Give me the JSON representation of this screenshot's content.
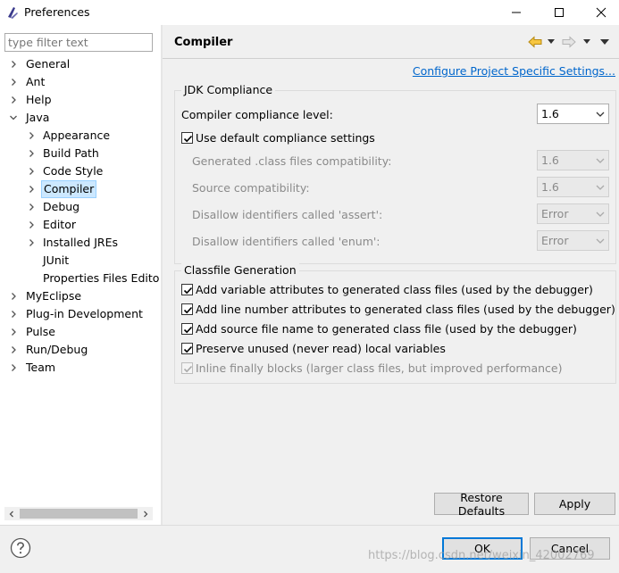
{
  "window": {
    "title": "Preferences",
    "minimize_glyph": "—",
    "maximize_glyph": "☐",
    "close_glyph": "✕"
  },
  "filter": {
    "placeholder": "type filter text",
    "value": ""
  },
  "tree": {
    "items": [
      {
        "label": "General",
        "level": 0,
        "expanded": false
      },
      {
        "label": "Ant",
        "level": 0,
        "expanded": false
      },
      {
        "label": "Help",
        "level": 0,
        "expanded": false
      },
      {
        "label": "Java",
        "level": 0,
        "expanded": true
      },
      {
        "label": "Appearance",
        "level": 1,
        "expanded": false
      },
      {
        "label": "Build Path",
        "level": 1,
        "expanded": false
      },
      {
        "label": "Code Style",
        "level": 1,
        "expanded": false
      },
      {
        "label": "Compiler",
        "level": 1,
        "expanded": false,
        "selected": true
      },
      {
        "label": "Debug",
        "level": 1,
        "expanded": false
      },
      {
        "label": "Editor",
        "level": 1,
        "expanded": false
      },
      {
        "label": "Installed JREs",
        "level": 1,
        "expanded": false
      },
      {
        "label": "JUnit",
        "level": 1,
        "leaf": true
      },
      {
        "label": "Properties Files Edito",
        "level": 1,
        "leaf": true
      },
      {
        "label": "MyEclipse",
        "level": 0,
        "expanded": false
      },
      {
        "label": "Plug-in Development",
        "level": 0,
        "expanded": false
      },
      {
        "label": "Pulse",
        "level": 0,
        "expanded": false
      },
      {
        "label": "Run/Debug",
        "level": 0,
        "expanded": false
      },
      {
        "label": "Team",
        "level": 0,
        "expanded": false
      }
    ]
  },
  "page": {
    "title": "Compiler",
    "configure_link": "Configure Project Specific Settings..."
  },
  "jdk": {
    "group_title": "JDK Compliance",
    "compliance_label": "Compiler compliance level:",
    "compliance_value": "1.6",
    "use_default_label": "Use default compliance settings",
    "use_default_checked": true,
    "generated_label": "Generated .class files compatibility:",
    "generated_value": "1.6",
    "source_label": "Source compatibility:",
    "source_value": "1.6",
    "assert_label": "Disallow identifiers called 'assert':",
    "assert_value": "Error",
    "enum_label": "Disallow identifiers called 'enum':",
    "enum_value": "Error"
  },
  "classfile": {
    "group_title": "Classfile Generation",
    "options": [
      {
        "label": "Add variable attributes to generated class files (used by the debugger)",
        "checked": true,
        "enabled": true
      },
      {
        "label": "Add line number attributes to generated class files (used by the debugger)",
        "checked": true,
        "enabled": true
      },
      {
        "label": "Add source file name to generated class file (used by the debugger)",
        "checked": true,
        "enabled": true
      },
      {
        "label": "Preserve unused (never read) local variables",
        "checked": true,
        "enabled": true
      },
      {
        "label": "Inline finally blocks (larger class files, but improved performance)",
        "checked": true,
        "enabled": false
      }
    ]
  },
  "buttons": {
    "restore_defaults": "Restore Defaults",
    "apply": "Apply",
    "ok": "OK",
    "cancel": "Cancel"
  },
  "watermark": "https://blog.csdn.net/weixin_42002769",
  "colors": {
    "selection_bg": "#cce8ff",
    "link": "#0066cc",
    "default_button_border": "#0078d7"
  }
}
